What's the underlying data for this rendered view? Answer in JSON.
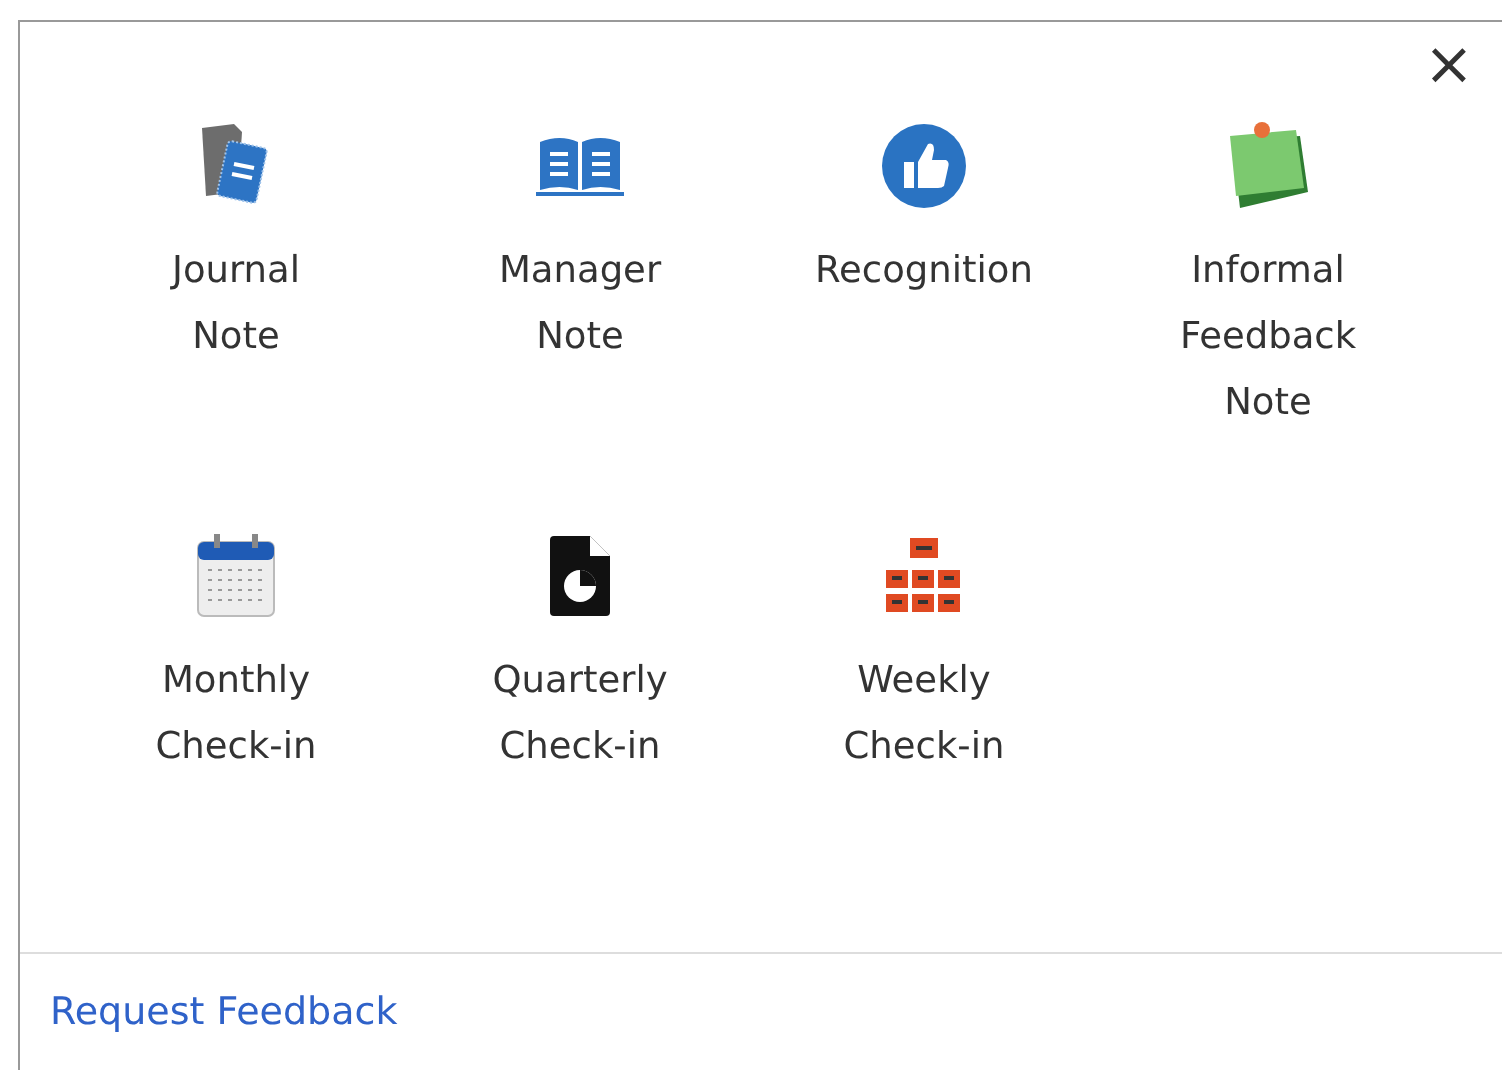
{
  "close": "×",
  "items": [
    {
      "label": "Journal\nNote"
    },
    {
      "label": "Manager\nNote"
    },
    {
      "label": "Recognition"
    },
    {
      "label": "Informal\nFeedback\nNote"
    },
    {
      "label": "Monthly\nCheck-in"
    },
    {
      "label": "Quarterly\nCheck-in"
    },
    {
      "label": "Weekly\nCheck-in"
    }
  ],
  "footer_link": "Request Feedback"
}
